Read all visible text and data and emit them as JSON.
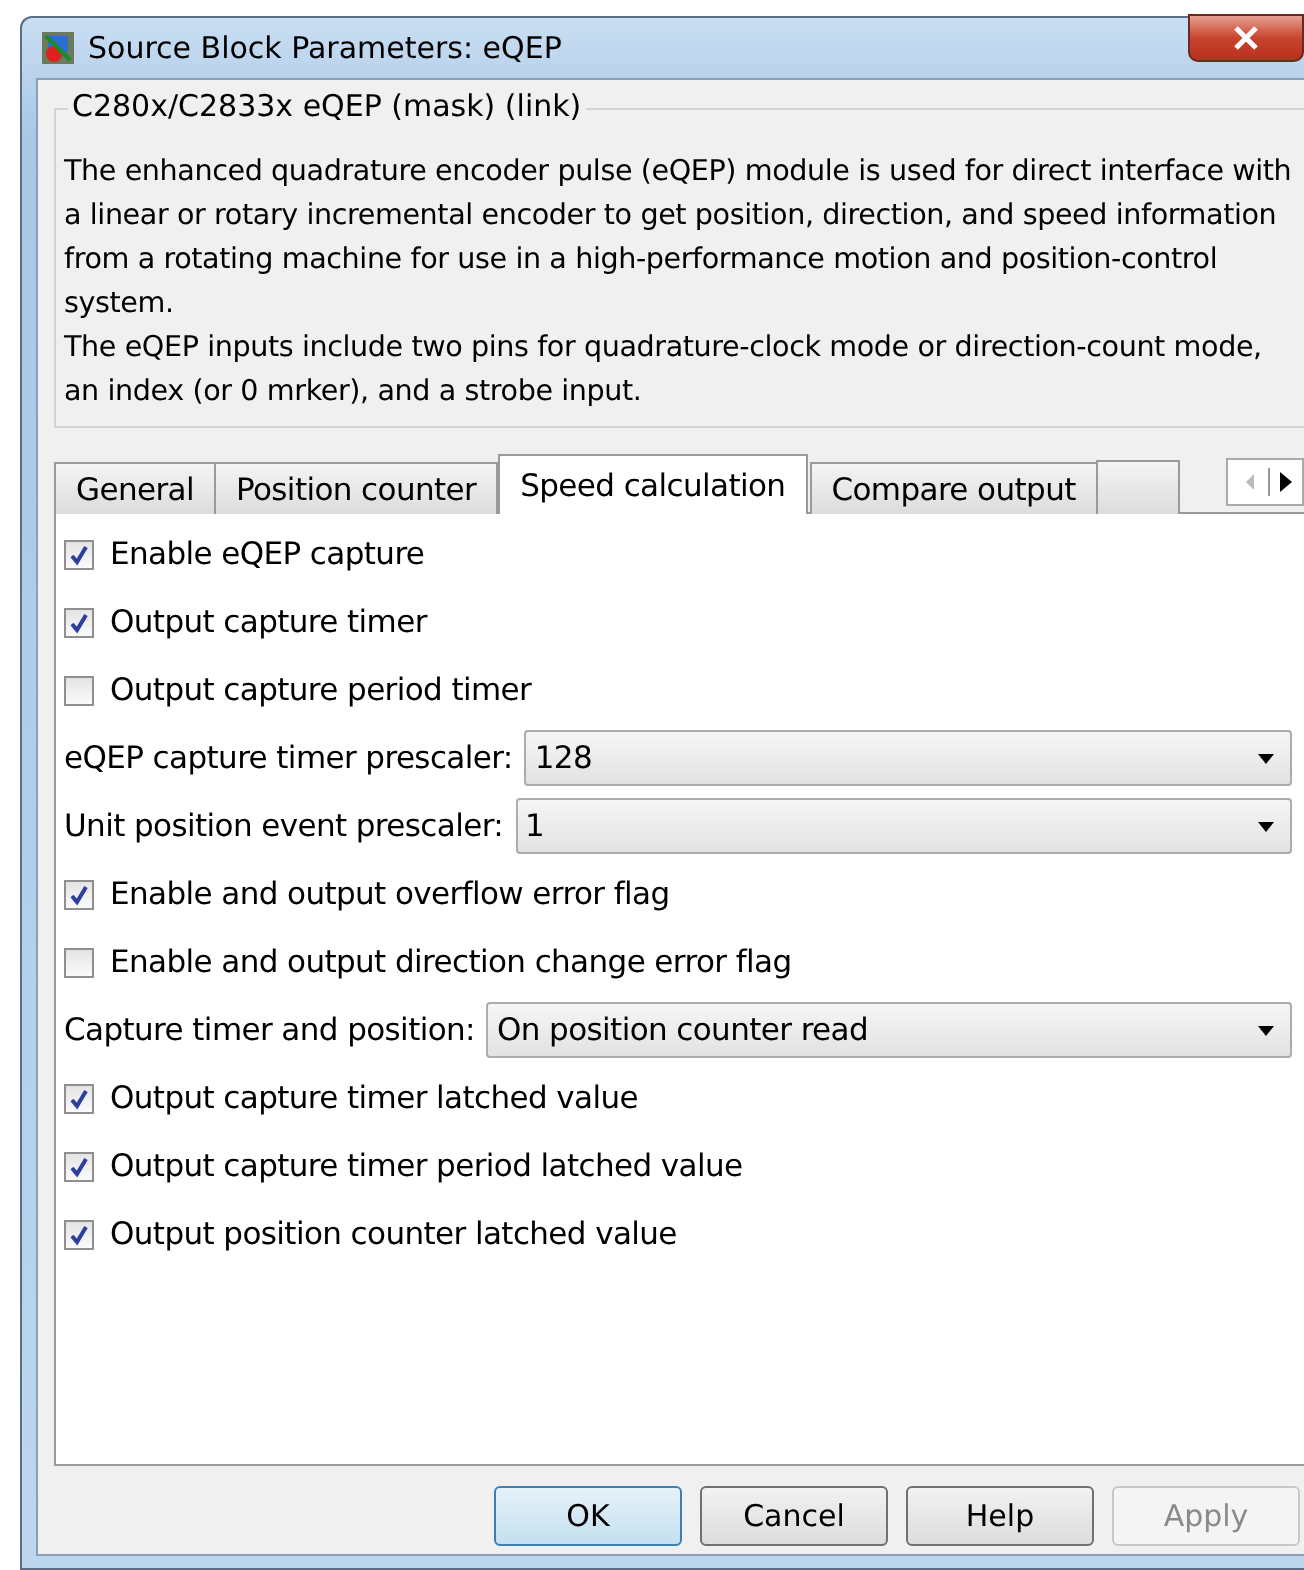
{
  "window": {
    "title": "Source Block Parameters: eQEP"
  },
  "group": {
    "title": "C280x/C2833x eQEP (mask) (link)",
    "paragraphs": [
      "The enhanced quadrature encoder pulse (eQEP) module is used for direct interface with a linear or rotary incremental encoder to get position, direction, and speed information from a rotating machine for use in a high-performance motion and position-control system.",
      "The eQEP inputs include two pins for quadrature-clock mode or direction-count mode, an index (or 0 mrker), and a strobe input."
    ]
  },
  "tabs": [
    {
      "label": "General",
      "selected": false
    },
    {
      "label": "Position counter",
      "selected": false
    },
    {
      "label": "Speed calculation",
      "selected": true
    },
    {
      "label": "Compare output",
      "selected": false
    }
  ],
  "parameters": [
    {
      "kind": "checkbox",
      "label": "Enable eQEP capture",
      "checked": true
    },
    {
      "kind": "checkbox",
      "label": "Output capture timer",
      "checked": true
    },
    {
      "kind": "checkbox",
      "label": "Output capture period timer",
      "checked": false
    },
    {
      "kind": "dropdown",
      "label": "eQEP capture timer prescaler:",
      "value": "128"
    },
    {
      "kind": "dropdown",
      "label": "Unit position event prescaler:",
      "value": "1"
    },
    {
      "kind": "checkbox",
      "label": "Enable and output overflow error flag",
      "checked": true
    },
    {
      "kind": "checkbox",
      "label": "Enable and output direction change error flag",
      "checked": false
    },
    {
      "kind": "dropdown",
      "label": "Capture timer and position:",
      "value": "On position counter read"
    },
    {
      "kind": "checkbox",
      "label": "Output capture timer latched value",
      "checked": true
    },
    {
      "kind": "checkbox",
      "label": "Output capture timer period latched value",
      "checked": true
    },
    {
      "kind": "checkbox",
      "label": "Output position counter latched value",
      "checked": true
    }
  ],
  "buttons": [
    {
      "label": "OK",
      "default": true,
      "disabled": false
    },
    {
      "label": "Cancel",
      "default": false,
      "disabled": false
    },
    {
      "label": "Help",
      "default": false,
      "disabled": false
    },
    {
      "label": "Apply",
      "default": false,
      "disabled": true
    }
  ]
}
